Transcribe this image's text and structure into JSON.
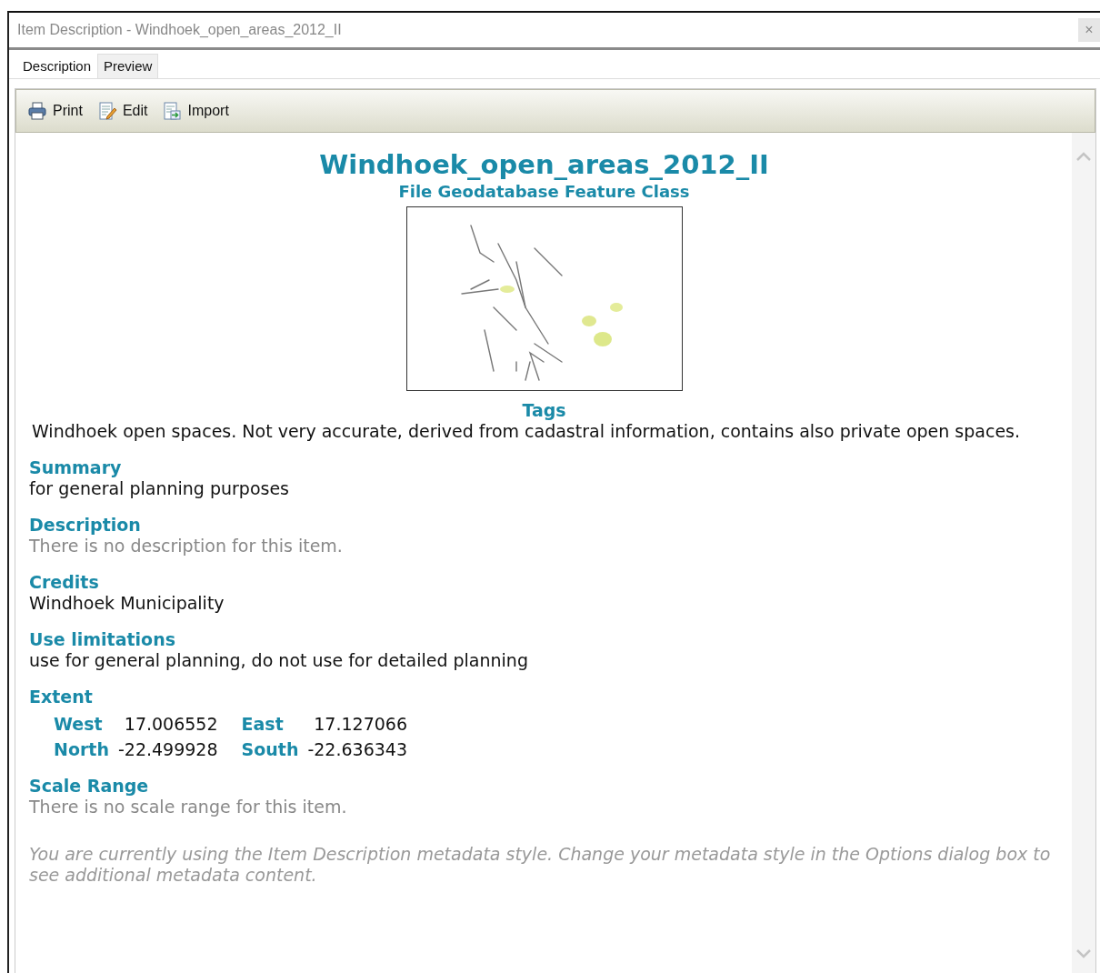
{
  "window": {
    "title": "Item Description - Windhoek_open_areas_2012_II",
    "close": "×"
  },
  "tabs": [
    {
      "label": "Description",
      "selected": true
    },
    {
      "label": "Preview",
      "selected": false
    }
  ],
  "toolbar": [
    {
      "label": "Print",
      "kind": "print"
    },
    {
      "label": "Edit",
      "kind": "edit"
    },
    {
      "label": "Import",
      "kind": "import"
    }
  ],
  "item": {
    "title": "Windhoek_open_areas_2012_II",
    "type": "File Geodatabase Feature Class"
  },
  "sections": [
    {
      "kind": "tags",
      "heading": "Tags",
      "text": "Windhoek open spaces. Not very accurate, derived from cadastral information, contains also private open spaces."
    },
    {
      "kind": "text",
      "heading": "Summary",
      "text": "for general planning purposes"
    },
    {
      "kind": "muted",
      "heading": "Description",
      "text": "There is no description for this item."
    },
    {
      "kind": "text",
      "heading": "Credits",
      "text": "Windhoek Municipality"
    },
    {
      "kind": "text",
      "heading": "Use limitations",
      "text": "use for general planning, do not use for detailed planning"
    },
    {
      "kind": "extent",
      "heading": "Extent",
      "rows": [
        [
          {
            "label": "West",
            "value": "17.006552"
          },
          {
            "label": "East",
            "value": "17.127066"
          }
        ],
        [
          {
            "label": "North",
            "value": "-22.499928"
          },
          {
            "label": "South",
            "value": "-22.636343"
          }
        ]
      ]
    },
    {
      "kind": "muted",
      "heading": "Scale Range",
      "text": "There is no scale range for this item."
    }
  ],
  "note": "You are currently using the Item Description metadata style. Change your metadata style in the Options dialog box to see additional metadata content."
}
